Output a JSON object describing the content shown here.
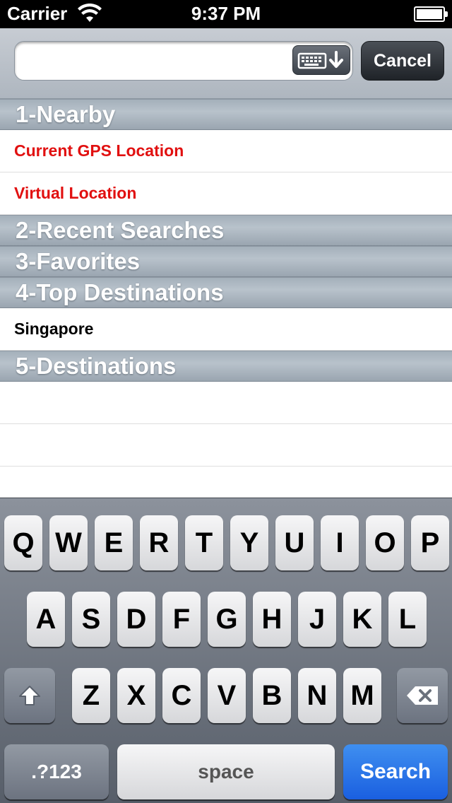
{
  "status": {
    "carrier": "Carrier",
    "time": "9:37 PM"
  },
  "search": {
    "query": "",
    "cancel_label": "Cancel"
  },
  "sections": [
    {
      "header": "1-Nearby",
      "rows": [
        "Current GPS Location",
        "Virtual Location"
      ]
    },
    {
      "header": "2-Recent Searches",
      "rows": []
    },
    {
      "header": "3-Favorites",
      "rows": []
    },
    {
      "header": "4-Top Destinations",
      "rows": [
        "Singapore"
      ]
    },
    {
      "header": "5-Destinations",
      "rows": []
    }
  ],
  "keyboard": {
    "row1": [
      "Q",
      "W",
      "E",
      "R",
      "T",
      "Y",
      "U",
      "I",
      "O",
      "P"
    ],
    "row2": [
      "A",
      "S",
      "D",
      "F",
      "G",
      "H",
      "J",
      "K",
      "L"
    ],
    "row3": [
      "Z",
      "X",
      "C",
      "V",
      "B",
      "N",
      "M"
    ],
    "numbers_label": ".?123",
    "space_label": "space",
    "search_label": "Search",
    "icons": {
      "shift": "shift-icon",
      "backspace": "backspace-icon",
      "dismiss": "keyboard-dismiss-icon"
    }
  },
  "colors": {
    "nearby_row_text": "#e11010",
    "search_key": "#1a5fe0"
  }
}
